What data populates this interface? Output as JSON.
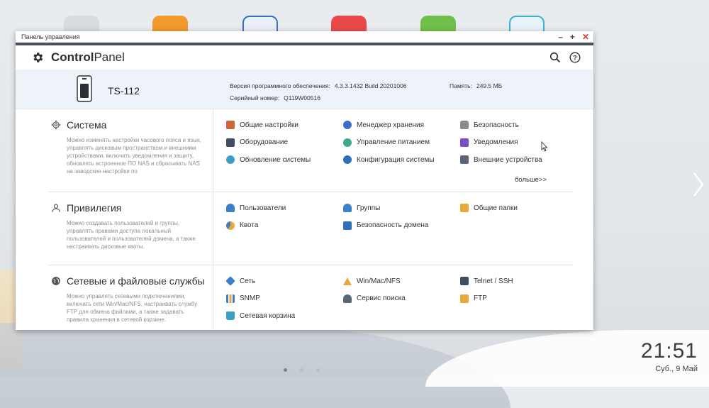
{
  "window": {
    "title": "Панель управления"
  },
  "header": {
    "logo_bold": "Control",
    "logo_rest": "Panel"
  },
  "device": {
    "name": "TS-112",
    "firmware_label": "Версия программного обеспечения:",
    "firmware_value": "4.3.3.1432 Build 20201006",
    "serial_label": "Серийный номер:",
    "serial_value": "Q119W00516",
    "memory_label": "Память:",
    "memory_value": "249.5 МБ"
  },
  "sections": [
    {
      "title": "Система",
      "icon": "gear-icon",
      "description": "Можно изменять настройки часового пояса и язык, управлять дисковым пространством и внешними устройствами, включать уведомления и защиту, обновлять встроенное ПО NAS и сбрасывать NAS на заводские настройки по",
      "items": [
        {
          "label": "Общие настройки",
          "icon": "general-settings-icon",
          "color": "#d0653a"
        },
        {
          "label": "Менеджер хранения",
          "icon": "storage-manager-icon",
          "color": "#3a6fc4"
        },
        {
          "label": "Безопасность",
          "icon": "lock-icon",
          "color": "#888c92"
        },
        {
          "label": "Оборудование",
          "icon": "hardware-icon",
          "color": "#3f4e60"
        },
        {
          "label": "Управление питанием",
          "icon": "power-bulb-icon",
          "color": "#3fa88f"
        },
        {
          "label": "Уведомления",
          "icon": "notification-icon",
          "color": "#7a4fc8"
        },
        {
          "label": "Обновление системы",
          "icon": "system-update-icon",
          "color": "#3aa0c8"
        },
        {
          "label": "Конфигурация системы",
          "icon": "system-config-icon",
          "color": "#2f6fb6"
        },
        {
          "label": "Внешние устройства",
          "icon": "external-device-icon",
          "color": "#5a6674"
        }
      ],
      "more": "больше>>"
    },
    {
      "title": "Привилегия",
      "icon": "user-outline-icon",
      "description": "Можно создавать пользователей и группы, управлять правами доступа локальный пользователей и пользователей домена, а также настраивать дисковые квоты.",
      "items": [
        {
          "label": "Пользователи",
          "icon": "user-icon",
          "color": "#3a7fc8"
        },
        {
          "label": "Группы",
          "icon": "group-icon",
          "color": "#3a7fc8"
        },
        {
          "label": "Общие папки",
          "icon": "shared-folder-icon",
          "color": "#e8a83a"
        },
        {
          "label": "Квота",
          "icon": "quota-icon",
          "color": "#e8a83a"
        },
        {
          "label": "Безопасность домена",
          "icon": "domain-security-icon",
          "color": "#2f6fb6"
        }
      ]
    },
    {
      "title": "Сетевые и файловые службы",
      "icon": "globe-icon",
      "description": "Можно управлять сетевыми подключениями, включать сети Win/Mac/NFS, настраивать службу FTP для обмена файлами, а также задавать правила хранения в сетевой корзине.",
      "items": [
        {
          "label": "Сеть",
          "icon": "network-icon",
          "color": "#3a7fc8"
        },
        {
          "label": "Win/Mac/NFS",
          "icon": "win-mac-nfs-icon",
          "color": "#e8a83a"
        },
        {
          "label": "Telnet / SSH",
          "icon": "terminal-icon",
          "color": "#3f4e60"
        },
        {
          "label": "SNMP",
          "icon": "snmp-chart-icon",
          "color": "#3a7fc8"
        },
        {
          "label": "Сервис поиска",
          "icon": "search-service-icon",
          "color": "#5a6674"
        },
        {
          "label": "FTP",
          "icon": "ftp-icon",
          "color": "#e8a83a"
        },
        {
          "label": "Сетевая корзина",
          "icon": "recycle-bin-icon",
          "color": "#3aa0c8"
        }
      ]
    }
  ],
  "desktop": {
    "time": "21:51",
    "date": "Суб., 9 Май",
    "app_icon_colors": [
      "#d9dcdf",
      "#f29a2e",
      "#e9eef7",
      "#e8484a",
      "#6fbf4a",
      "#e8f2f8"
    ]
  }
}
